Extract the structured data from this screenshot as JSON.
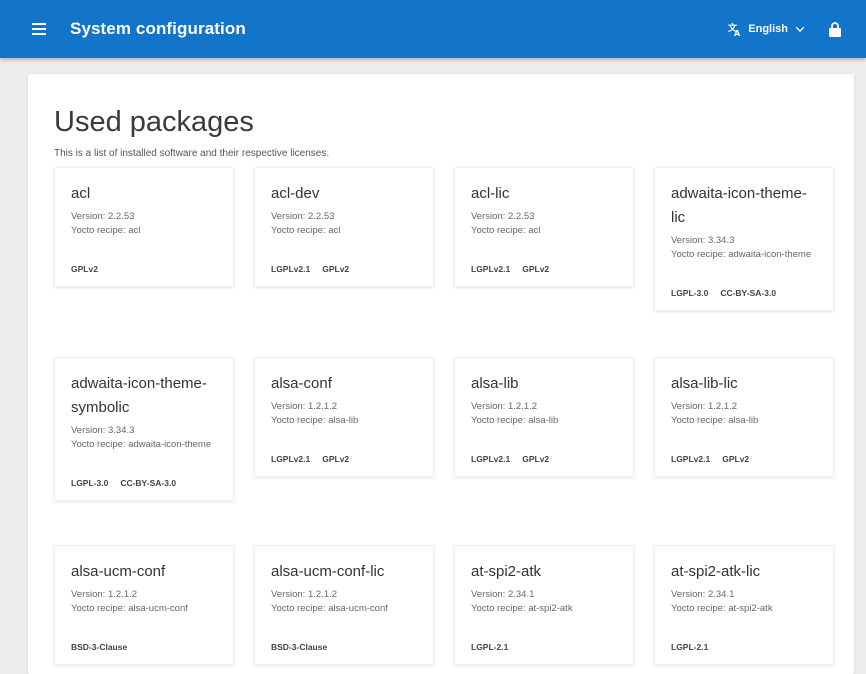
{
  "header": {
    "title": "System configuration",
    "menu_icon": "menu-icon",
    "language": "English",
    "language_icon": "translate-icon",
    "lock_icon": "lock-icon",
    "bg_color": "#1275c9"
  },
  "page": {
    "title": "Used packages",
    "description": "This is a list of installed software and their respective licenses."
  },
  "labels": {
    "version_prefix": "Version: ",
    "recipe_prefix": "Yocto recipe: "
  },
  "packages": [
    {
      "name": "acl",
      "version": "2.2.53",
      "recipe": "acl",
      "licenses": [
        "GPLv2"
      ]
    },
    {
      "name": "acl-dev",
      "version": "2.2.53",
      "recipe": "acl",
      "licenses": [
        "LGPLv2.1",
        "GPLv2"
      ]
    },
    {
      "name": "acl-lic",
      "version": "2.2.53",
      "recipe": "acl",
      "licenses": [
        "LGPLv2.1",
        "GPLv2"
      ]
    },
    {
      "name": "adwaita-icon-theme-lic",
      "version": "3.34.3",
      "recipe": "adwaita-icon-theme",
      "licenses": [
        "LGPL-3.0",
        "CC-BY-SA-3.0"
      ]
    },
    {
      "name": "adwaita-icon-theme-symbolic",
      "version": "3.34.3",
      "recipe": "adwaita-icon-theme",
      "licenses": [
        "LGPL-3.0",
        "CC-BY-SA-3.0"
      ]
    },
    {
      "name": "alsa-conf",
      "version": "1.2.1.2",
      "recipe": "alsa-lib",
      "licenses": [
        "LGPLv2.1",
        "GPLv2"
      ]
    },
    {
      "name": "alsa-lib",
      "version": "1.2.1.2",
      "recipe": "alsa-lib",
      "licenses": [
        "LGPLv2.1",
        "GPLv2"
      ]
    },
    {
      "name": "alsa-lib-lic",
      "version": "1.2.1.2",
      "recipe": "alsa-lib",
      "licenses": [
        "LGPLv2.1",
        "GPLv2"
      ]
    },
    {
      "name": "alsa-ucm-conf",
      "version": "1.2.1.2",
      "recipe": "alsa-ucm-conf",
      "licenses": [
        "BSD-3-Clause"
      ]
    },
    {
      "name": "alsa-ucm-conf-lic",
      "version": "1.2.1.2",
      "recipe": "alsa-ucm-conf",
      "licenses": [
        "BSD-3-Clause"
      ]
    },
    {
      "name": "at-spi2-atk",
      "version": "2.34.1",
      "recipe": "at-spi2-atk",
      "licenses": [
        "LGPL-2.1"
      ]
    },
    {
      "name": "at-spi2-atk-lic",
      "version": "2.34.1",
      "recipe": "at-spi2-atk",
      "licenses": [
        "LGPL-2.1"
      ]
    }
  ]
}
